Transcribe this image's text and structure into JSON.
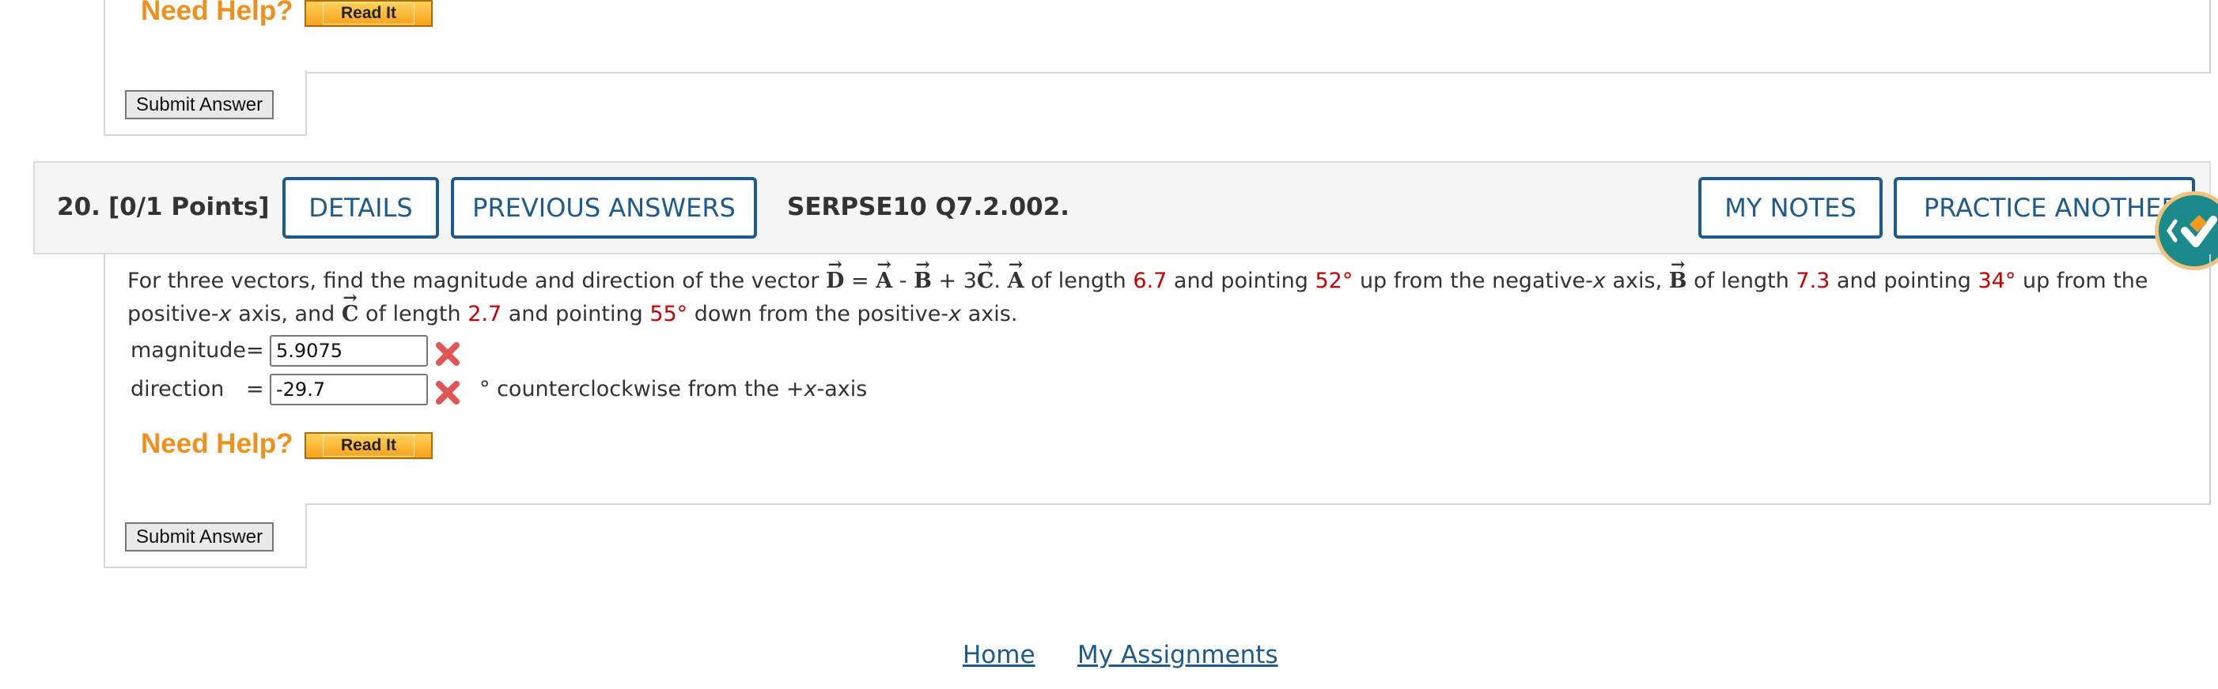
{
  "top_section": {
    "need_help": "Need Help?",
    "read_it": "Read It",
    "submit": "Submit Answer"
  },
  "question": {
    "number": "20.",
    "points": "[0/1 Points]",
    "details_button": "DETAILS",
    "previous_answers_button": "PREVIOUS ANSWERS",
    "code": "SERPSE10 Q7.2.002.",
    "my_notes_button": "MY NOTES",
    "practice_another_button": "PRACTICE ANOTHER",
    "text": {
      "t1": "For three vectors, find the magnitude and direction of the vector ",
      "v_d": "D",
      "t2": " = ",
      "v_a": "A",
      "t3": " - ",
      "v_b": "B",
      "t4": " + 3",
      "v_c": "C",
      "t5": ". ",
      "v_a2": "A",
      "t6": " of length ",
      "a_len": "6.7",
      "t7": " and pointing ",
      "a_ang": "52°",
      "t8": " up from the negative-",
      "x1": "x",
      "t9": " axis, ",
      "v_b2": "B",
      "t10": " of length ",
      "b_len": "7.3",
      "t11": " and pointing ",
      "b_ang": "34°",
      "t12": " up from the",
      "t13": "positive-",
      "x2": "x",
      "t14": " axis, and ",
      "v_c2": "C",
      "t15": " of length ",
      "c_len": "2.7",
      "t16": " and pointing ",
      "c_ang": "55°",
      "t17": " down from the positive-",
      "x3": "x",
      "t18": " axis."
    },
    "magnitude_label": "magnitude",
    "equals": "=",
    "magnitude_value": "5.9075",
    "direction_label": "direction",
    "direction_value": "-29.7",
    "direction_unit_pre": "° counterclockwise from the +",
    "direction_unit_x": "x",
    "direction_unit_post": "-axis",
    "need_help": "Need Help?",
    "read_it": "Read It",
    "submit": "Submit Answer"
  },
  "footer": {
    "home": "Home",
    "my_assignments": "My Assignments"
  },
  "colors": {
    "accent": "#1d5a8d",
    "help": "#f0901c",
    "incorrect": "#e05656",
    "value_red": "#c80000",
    "badge_teal": "#1a8a8a"
  }
}
